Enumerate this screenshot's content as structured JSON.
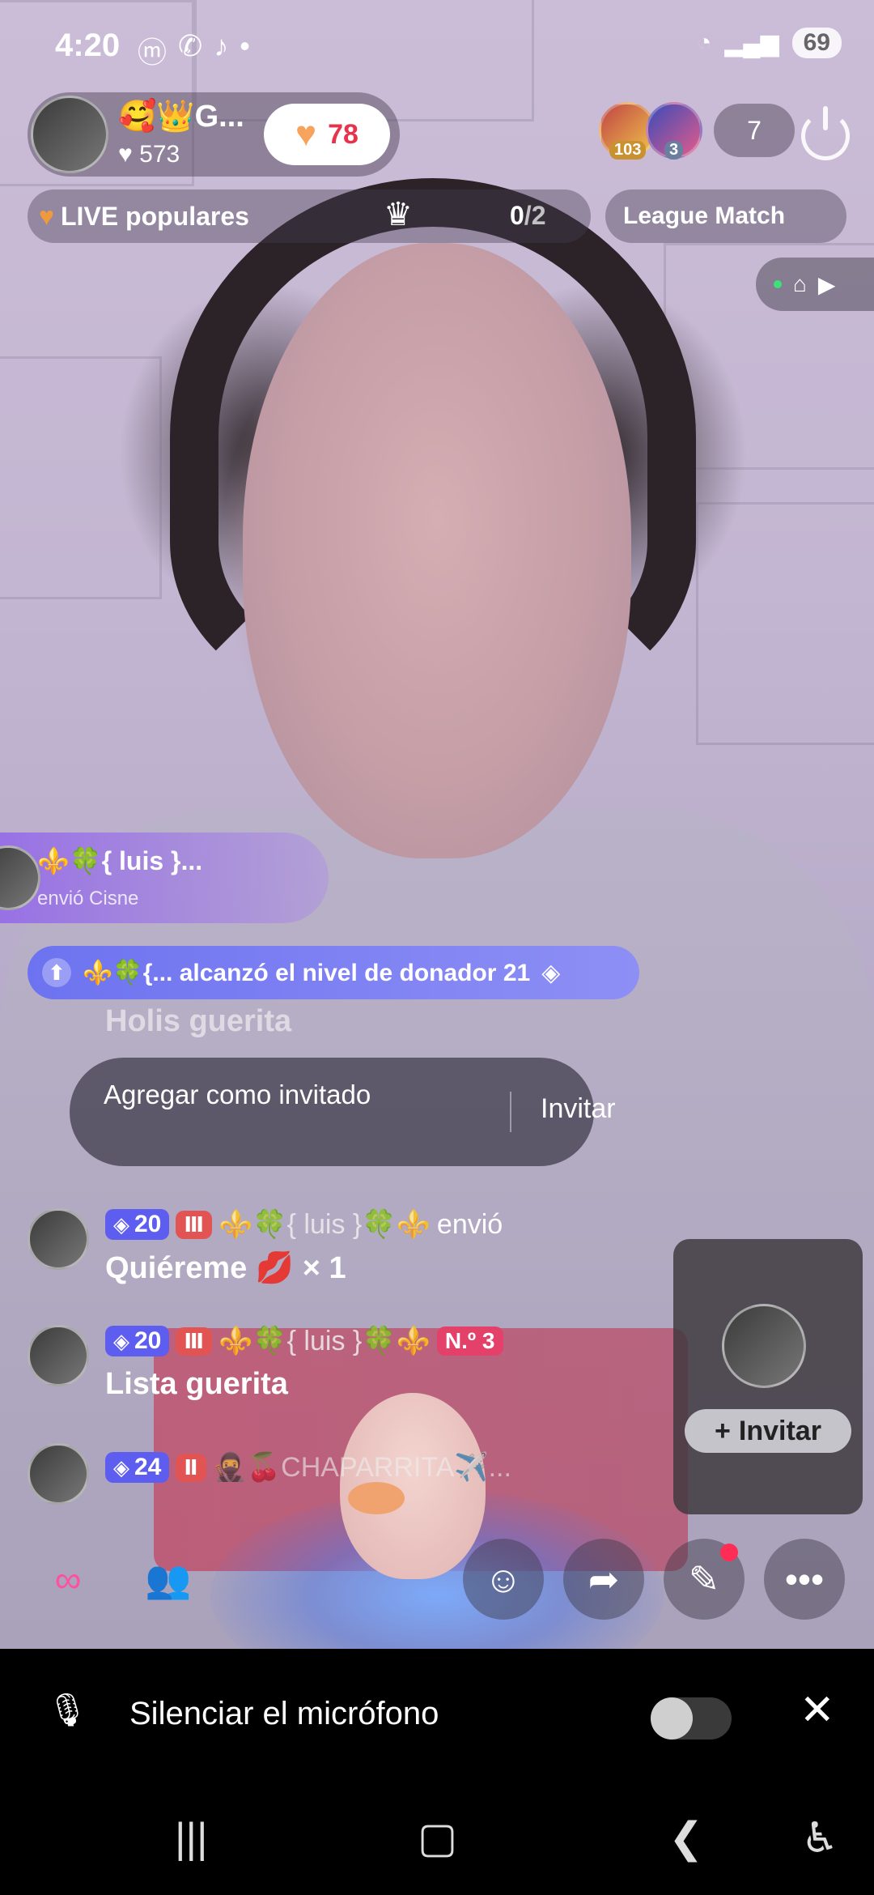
{
  "status_bar": {
    "time": "4:20",
    "app_icons": [
      "messenger-icon",
      "whatsapp-icon",
      "tiktok-icon",
      "dot"
    ],
    "battery": "69"
  },
  "host": {
    "name": "🥰👑G...",
    "likes": "573",
    "like_button_count": "78"
  },
  "viewers": {
    "badges": [
      "103",
      "3"
    ],
    "count": "7"
  },
  "popular": {
    "label": "LIVE populares",
    "score_current": "0",
    "score_total": "/2"
  },
  "league": {
    "label": "League Match"
  },
  "gift_notification": {
    "name": "⚜️🍀{ luis }...",
    "text": "envió Cisne"
  },
  "level_banner": {
    "text": "⚜️🍀{... alcanzó el nivel de donador 21"
  },
  "faded_comment": "Holis guerita",
  "invite_prompt": {
    "left": "Agregar como invitado",
    "right": "Invitar"
  },
  "comments": [
    {
      "level": "20",
      "user": "⚜️🍀{ luis }🍀⚜️",
      "action": "envió",
      "text": "Quiéreme 💋 × 1"
    },
    {
      "level": "20",
      "user": "⚜️🍀{ luis }🍀⚜️",
      "rank": "N.º 3",
      "text": "Lista guerita"
    },
    {
      "level": "24",
      "user": "🥷🍒CHAPARRITA✈️..."
    }
  ],
  "guest_card": {
    "invite_label": "Invitar"
  },
  "mic_bar": {
    "label": "Silenciar el micrófono"
  },
  "colors": {
    "accent": "#e8334d",
    "level": "#5d5ef0",
    "gift": "#9b70e6"
  }
}
